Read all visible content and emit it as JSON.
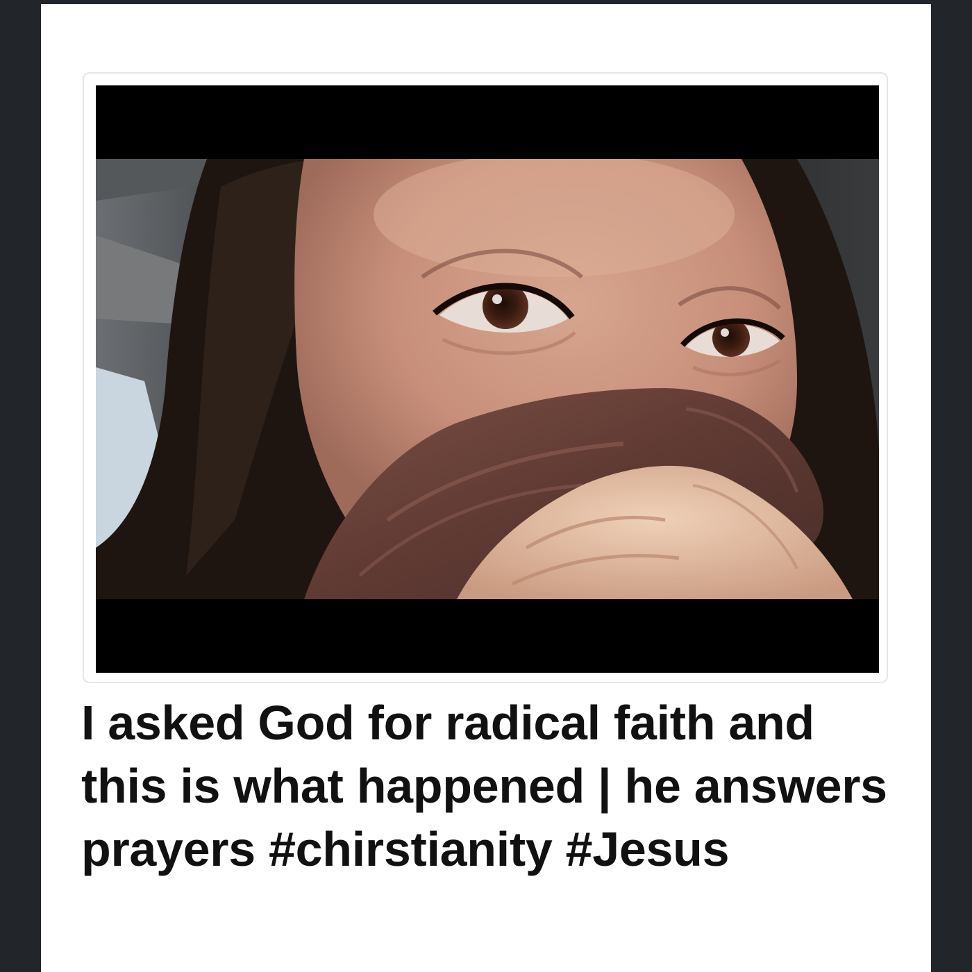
{
  "video": {
    "title": "I asked God for radical faith and this is what happened | he answers prayers #chirstianity #Jesus",
    "thumbnail_icon": "video-thumbnail"
  },
  "colors": {
    "background_dark": "#22262b",
    "card": "#ffffff",
    "title_text": "#111111"
  }
}
